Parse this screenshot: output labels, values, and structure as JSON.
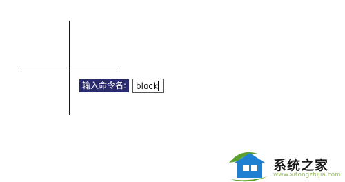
{
  "prompt": {
    "label": "输入命令名:",
    "input_value": "block"
  },
  "watermark": {
    "site_name": "系统之家",
    "url": "www.xitongzhijia.com",
    "colors": {
      "blue": "#1f7fd0",
      "green": "#5aa02c"
    }
  },
  "colors": {
    "crosshair": "#1a1a1a",
    "label_bg": "#2a2a6e",
    "label_text": "#ffffff"
  }
}
